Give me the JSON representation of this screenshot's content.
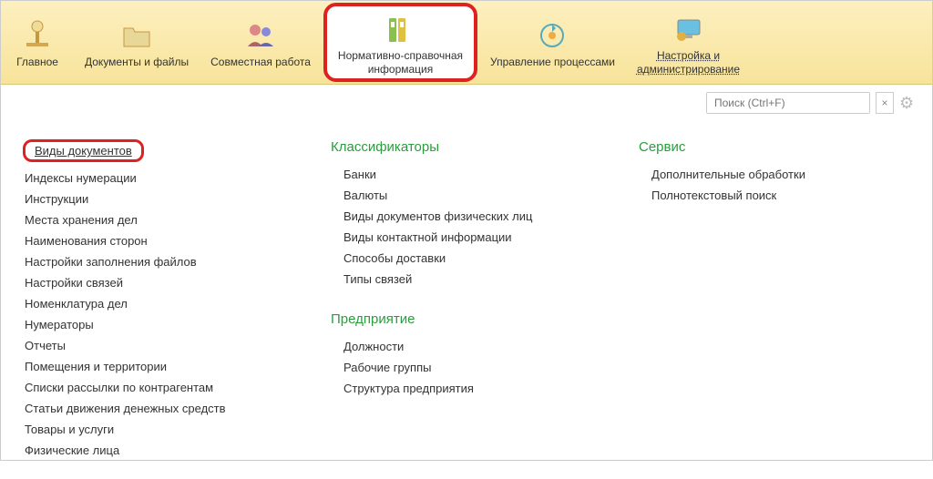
{
  "toolbar": {
    "items": [
      {
        "id": "main",
        "label": "Главное",
        "icon": "scale-icon"
      },
      {
        "id": "docs",
        "label": "Документы и файлы",
        "icon": "folder-icon"
      },
      {
        "id": "collab",
        "label": "Совместная работа",
        "icon": "people-icon"
      },
      {
        "id": "reference",
        "label": "Нормативно-справочная\nинформация",
        "icon": "binders-icon",
        "active": true
      },
      {
        "id": "process",
        "label": "Управление процессами",
        "icon": "workflow-icon"
      },
      {
        "id": "settings",
        "label": "Настройка и\nадминистрирование",
        "icon": "monitor-icon",
        "settings": true
      }
    ]
  },
  "search": {
    "placeholder": "Поиск (Ctrl+F)",
    "clear": "×"
  },
  "columns": {
    "col1": {
      "featured": "Виды документов",
      "items": [
        "Индексы нумерации",
        "Инструкции",
        "Места хранения дел",
        "Наименования сторон",
        "Настройки заполнения файлов",
        "Настройки связей",
        "Номенклатура дел",
        "Нумераторы",
        "Отчеты",
        "Помещения и территории",
        "Списки рассылки по контрагентам",
        "Статьи движения денежных средств",
        "Товары и услуги",
        "Физические лица"
      ]
    },
    "col2": {
      "sections": [
        {
          "title": "Классификаторы",
          "items": [
            "Банки",
            "Валюты",
            "Виды документов физических лиц",
            "Виды контактной информации",
            "Способы доставки",
            "Типы связей"
          ]
        },
        {
          "title": "Предприятие",
          "items": [
            "Должности",
            "Рабочие группы",
            "Структура предприятия"
          ]
        }
      ]
    },
    "col3": {
      "sections": [
        {
          "title": "Сервис",
          "items": [
            "Дополнительные обработки",
            "Полнотекстовый поиск"
          ]
        }
      ]
    }
  }
}
